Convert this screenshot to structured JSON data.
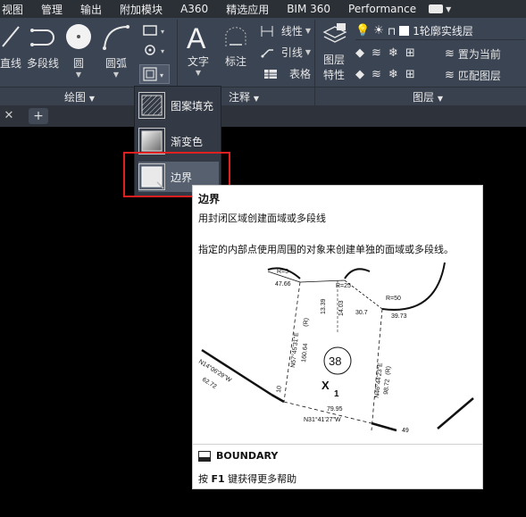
{
  "menubar": {
    "items": [
      "视图",
      "管理",
      "输出",
      "附加模块",
      "A360",
      "精选应用",
      "BIM 360",
      "Performance"
    ]
  },
  "ribbon": {
    "draw": {
      "line_label": "直线",
      "polyline_label": "多段线",
      "circle_label": "圆",
      "arc_label": "圆弧"
    },
    "annotation": {
      "text_label": "文字",
      "dimension_label": "标注",
      "linetype_label": "线性",
      "leader_label": "引线",
      "table_label": "表格"
    },
    "layers": {
      "properties_label_1": "图层",
      "properties_label_2": "特性",
      "current_layer": "1轮廓实线层",
      "set_current_label": "置为当前",
      "match_layer_label": "匹配图层"
    }
  },
  "panels": {
    "draw": "绘图",
    "annotation": "注释",
    "layers": "图层"
  },
  "dropdown": {
    "items": [
      "图案填充",
      "渐变色",
      "边界"
    ]
  },
  "tooltip": {
    "title": "边界",
    "summary": "用封闭区域创建面域或多段线",
    "description": "指定的内部点使用周围的对象来创建单独的面域或多段线。",
    "command": "BOUNDARY",
    "help_prefix": "按",
    "help_key": "F1",
    "help_suffix": "键获得更多帮助"
  },
  "illustration": {
    "labels": [
      "R=5",
      "R=25",
      "R=50",
      "47.66",
      "13.39",
      "14.03",
      "30.7",
      "39.73",
      "N57°45'31\"E",
      "160.64",
      "(R)",
      "N14°06'29\"W",
      "62.72",
      "10",
      "N46°44'23\"E",
      "98.72",
      "(R)",
      "79.95",
      "N31°41'27\"W",
      "49",
      "38",
      "X",
      "1"
    ]
  }
}
